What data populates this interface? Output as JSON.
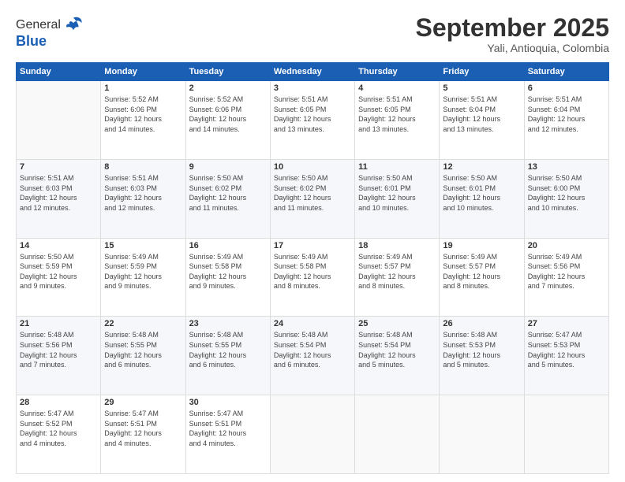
{
  "header": {
    "logo_line1": "General",
    "logo_line2": "Blue",
    "title": "September 2025",
    "subtitle": "Yali, Antioquia, Colombia"
  },
  "days_of_week": [
    "Sunday",
    "Monday",
    "Tuesday",
    "Wednesday",
    "Thursday",
    "Friday",
    "Saturday"
  ],
  "weeks": [
    [
      {
        "date": "",
        "info": ""
      },
      {
        "date": "1",
        "info": "Sunrise: 5:52 AM\nSunset: 6:06 PM\nDaylight: 12 hours\nand 14 minutes."
      },
      {
        "date": "2",
        "info": "Sunrise: 5:52 AM\nSunset: 6:06 PM\nDaylight: 12 hours\nand 14 minutes."
      },
      {
        "date": "3",
        "info": "Sunrise: 5:51 AM\nSunset: 6:05 PM\nDaylight: 12 hours\nand 13 minutes."
      },
      {
        "date": "4",
        "info": "Sunrise: 5:51 AM\nSunset: 6:05 PM\nDaylight: 12 hours\nand 13 minutes."
      },
      {
        "date": "5",
        "info": "Sunrise: 5:51 AM\nSunset: 6:04 PM\nDaylight: 12 hours\nand 13 minutes."
      },
      {
        "date": "6",
        "info": "Sunrise: 5:51 AM\nSunset: 6:04 PM\nDaylight: 12 hours\nand 12 minutes."
      }
    ],
    [
      {
        "date": "7",
        "info": "Sunrise: 5:51 AM\nSunset: 6:03 PM\nDaylight: 12 hours\nand 12 minutes."
      },
      {
        "date": "8",
        "info": "Sunrise: 5:51 AM\nSunset: 6:03 PM\nDaylight: 12 hours\nand 12 minutes."
      },
      {
        "date": "9",
        "info": "Sunrise: 5:50 AM\nSunset: 6:02 PM\nDaylight: 12 hours\nand 11 minutes."
      },
      {
        "date": "10",
        "info": "Sunrise: 5:50 AM\nSunset: 6:02 PM\nDaylight: 12 hours\nand 11 minutes."
      },
      {
        "date": "11",
        "info": "Sunrise: 5:50 AM\nSunset: 6:01 PM\nDaylight: 12 hours\nand 10 minutes."
      },
      {
        "date": "12",
        "info": "Sunrise: 5:50 AM\nSunset: 6:01 PM\nDaylight: 12 hours\nand 10 minutes."
      },
      {
        "date": "13",
        "info": "Sunrise: 5:50 AM\nSunset: 6:00 PM\nDaylight: 12 hours\nand 10 minutes."
      }
    ],
    [
      {
        "date": "14",
        "info": "Sunrise: 5:50 AM\nSunset: 5:59 PM\nDaylight: 12 hours\nand 9 minutes."
      },
      {
        "date": "15",
        "info": "Sunrise: 5:49 AM\nSunset: 5:59 PM\nDaylight: 12 hours\nand 9 minutes."
      },
      {
        "date": "16",
        "info": "Sunrise: 5:49 AM\nSunset: 5:58 PM\nDaylight: 12 hours\nand 9 minutes."
      },
      {
        "date": "17",
        "info": "Sunrise: 5:49 AM\nSunset: 5:58 PM\nDaylight: 12 hours\nand 8 minutes."
      },
      {
        "date": "18",
        "info": "Sunrise: 5:49 AM\nSunset: 5:57 PM\nDaylight: 12 hours\nand 8 minutes."
      },
      {
        "date": "19",
        "info": "Sunrise: 5:49 AM\nSunset: 5:57 PM\nDaylight: 12 hours\nand 8 minutes."
      },
      {
        "date": "20",
        "info": "Sunrise: 5:49 AM\nSunset: 5:56 PM\nDaylight: 12 hours\nand 7 minutes."
      }
    ],
    [
      {
        "date": "21",
        "info": "Sunrise: 5:48 AM\nSunset: 5:56 PM\nDaylight: 12 hours\nand 7 minutes."
      },
      {
        "date": "22",
        "info": "Sunrise: 5:48 AM\nSunset: 5:55 PM\nDaylight: 12 hours\nand 6 minutes."
      },
      {
        "date": "23",
        "info": "Sunrise: 5:48 AM\nSunset: 5:55 PM\nDaylight: 12 hours\nand 6 minutes."
      },
      {
        "date": "24",
        "info": "Sunrise: 5:48 AM\nSunset: 5:54 PM\nDaylight: 12 hours\nand 6 minutes."
      },
      {
        "date": "25",
        "info": "Sunrise: 5:48 AM\nSunset: 5:54 PM\nDaylight: 12 hours\nand 5 minutes."
      },
      {
        "date": "26",
        "info": "Sunrise: 5:48 AM\nSunset: 5:53 PM\nDaylight: 12 hours\nand 5 minutes."
      },
      {
        "date": "27",
        "info": "Sunrise: 5:47 AM\nSunset: 5:53 PM\nDaylight: 12 hours\nand 5 minutes."
      }
    ],
    [
      {
        "date": "28",
        "info": "Sunrise: 5:47 AM\nSunset: 5:52 PM\nDaylight: 12 hours\nand 4 minutes."
      },
      {
        "date": "29",
        "info": "Sunrise: 5:47 AM\nSunset: 5:51 PM\nDaylight: 12 hours\nand 4 minutes."
      },
      {
        "date": "30",
        "info": "Sunrise: 5:47 AM\nSunset: 5:51 PM\nDaylight: 12 hours\nand 4 minutes."
      },
      {
        "date": "",
        "info": ""
      },
      {
        "date": "",
        "info": ""
      },
      {
        "date": "",
        "info": ""
      },
      {
        "date": "",
        "info": ""
      }
    ]
  ]
}
